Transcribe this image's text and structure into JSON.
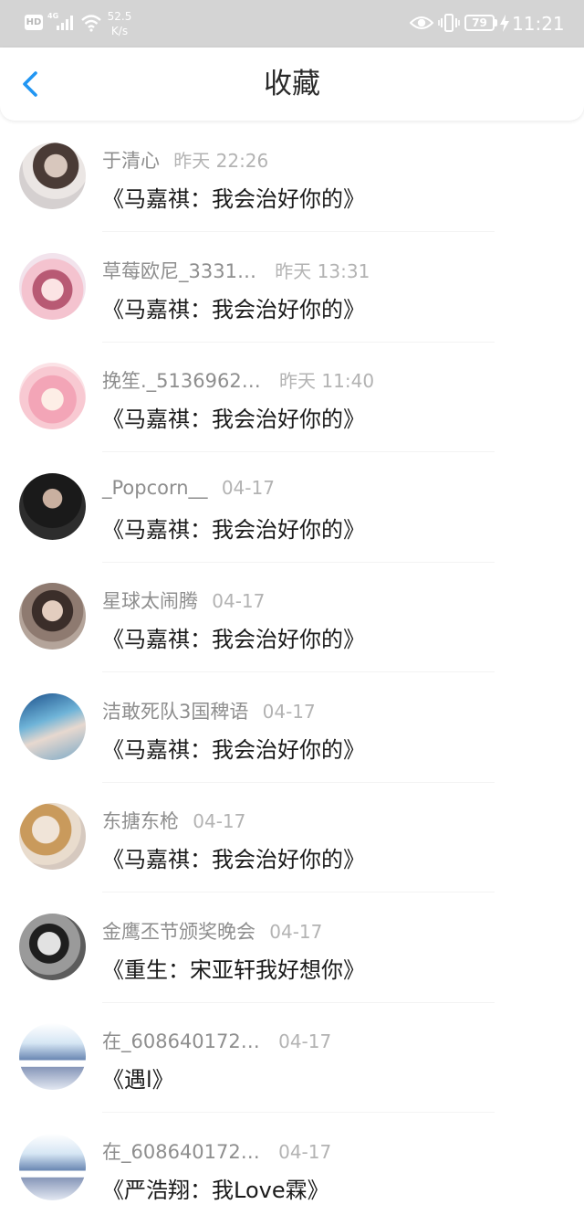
{
  "status_bar": {
    "hd_label": "HD",
    "network": "4G",
    "speed": "52.5 K/s",
    "battery": "79",
    "time": "11:21"
  },
  "header": {
    "title": "收藏",
    "back_icon": "chevron-left-icon"
  },
  "colors": {
    "accent": "#2196f3",
    "status_bar_bg": "#d4d4d4"
  },
  "favorites": [
    {
      "user": "于清心",
      "time": "昨天 22:26",
      "title": "《马嘉祺：我会治好你的》"
    },
    {
      "user": "草莓欧尼_3331…",
      "time": "昨天 13:31",
      "title": "《马嘉祺：我会治好你的》"
    },
    {
      "user": "挽笙._5136962…",
      "time": "昨天 11:40",
      "title": "《马嘉祺：我会治好你的》"
    },
    {
      "user": "_Popcorn__",
      "time": "04-17",
      "title": "《马嘉祺：我会治好你的》"
    },
    {
      "user": "星球太闹腾",
      "time": "04-17",
      "title": "《马嘉祺：我会治好你的》"
    },
    {
      "user": "洁敢死队3国稗语",
      "time": "04-17",
      "title": "《马嘉祺：我会治好你的》"
    },
    {
      "user": "东搪东枪",
      "time": "04-17",
      "title": "《马嘉祺：我会治好你的》"
    },
    {
      "user": "金鹰丕节颁奖晚会",
      "time": "04-17",
      "title": "《重生：宋亚轩我好想你》"
    },
    {
      "user": "在_608640172…",
      "time": "04-17",
      "title": "《遇l》"
    },
    {
      "user": "在_608640172…",
      "time": "04-17",
      "title": "《严浩翔：我Love霖》"
    }
  ]
}
